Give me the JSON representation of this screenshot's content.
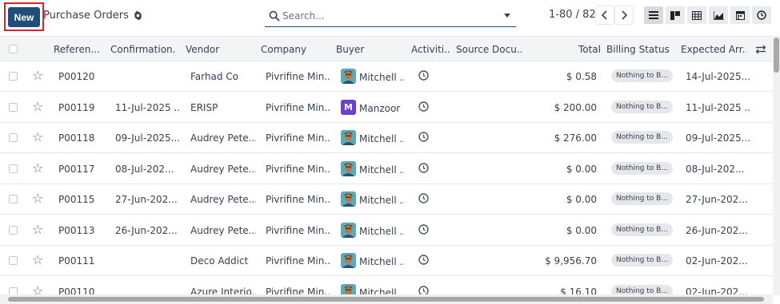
{
  "toolbar": {
    "new_label": "New",
    "title": "Purchase Orders",
    "search_placeholder": "Search...",
    "pager": "1-80 / 82"
  },
  "icons": {
    "settings": "gear-icon",
    "search": "search-icon",
    "prev": "chevron-left-icon",
    "next": "chevron-right-icon",
    "views": [
      "list-view-icon",
      "kanban-view-icon",
      "pivot-view-icon",
      "graph-view-icon",
      "calendar-view-icon",
      "activity-view-icon"
    ]
  },
  "colors": {
    "primary": "#1e4e79",
    "highlight": "#d9232e",
    "avatar_m": "#6b3fd3"
  },
  "columns": {
    "reference": "Referen...",
    "confirmation": "Confirmation...",
    "vendor": "Vendor",
    "company": "Company",
    "buyer": "Buyer",
    "activities": "Activiti...",
    "source": "Source Docu...",
    "total": "Total",
    "billing": "Billing Status",
    "expected": "Expected Arr..."
  },
  "rows": [
    {
      "ref": "P00120",
      "confirm": "",
      "vendor": "Farhad Co",
      "company": "Pivrifine Min...",
      "buyer": "Mitchell ...",
      "avatar": "photo",
      "total": "$ 0.58",
      "billing": "Nothing to B...",
      "expected": "14-Jul-2025..."
    },
    {
      "ref": "P00119",
      "confirm": "11-Jul-2025 ...",
      "vendor": "ERISP",
      "company": "Pivrifine Min...",
      "buyer": "Manzoor",
      "avatar": "M",
      "total": "$ 200.00",
      "billing": "Nothing to B...",
      "expected": "11-Jul-2025 ..."
    },
    {
      "ref": "P00118",
      "confirm": "09-Jul-2025...",
      "vendor": "Audrey Pete...",
      "company": "Pivrifine Min...",
      "buyer": "Mitchell ...",
      "avatar": "photo",
      "total": "$ 276.00",
      "billing": "Nothing to B...",
      "expected": "09-Jul-2025..."
    },
    {
      "ref": "P00117",
      "confirm": "08-Jul-202...",
      "vendor": "Audrey Pete...",
      "company": "Pivrifine Min...",
      "buyer": "Mitchell ...",
      "avatar": "photo",
      "total": "$ 0.00",
      "billing": "Nothing to B...",
      "expected": "08-Jul-202..."
    },
    {
      "ref": "P00115",
      "confirm": "27-Jun-202...",
      "vendor": "Audrey Pete...",
      "company": "Pivrifine Min...",
      "buyer": "Mitchell ...",
      "avatar": "photo",
      "total": "$ 0.00",
      "billing": "Nothing to B...",
      "expected": "27-Jun-202..."
    },
    {
      "ref": "P00113",
      "confirm": "26-Jun-202...",
      "vendor": "Audrey Pete...",
      "company": "Pivrifine Min...",
      "buyer": "Mitchell ...",
      "avatar": "photo",
      "total": "$ 0.00",
      "billing": "Nothing to B...",
      "expected": "26-Jun-202..."
    },
    {
      "ref": "P00111",
      "confirm": "",
      "vendor": "Deco Addict",
      "company": "Pivrifine Min...",
      "buyer": "Mitchell ...",
      "avatar": "photo",
      "total": "$ 9,956.70",
      "billing": "Nothing to B...",
      "expected": "02-Jun-202..."
    },
    {
      "ref": "P00110",
      "confirm": "",
      "vendor": "Azure Interio...",
      "company": "Pivrifine Min...",
      "buyer": "Mitchell ...",
      "avatar": "photo",
      "total": "$ 16.10",
      "billing": "Nothing to B...",
      "expected": "02-Jun-202..."
    }
  ]
}
